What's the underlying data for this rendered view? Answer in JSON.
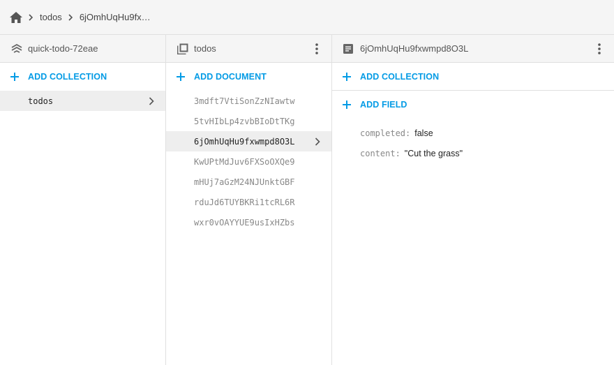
{
  "breadcrumb": {
    "home_icon": "home-icon",
    "items": [
      "todos",
      "6jOmhUqHu9fx…"
    ]
  },
  "colors": {
    "accent": "#039be5",
    "header_bg": "#f5f5f5",
    "selected_bg": "#eeeeee"
  },
  "pane_project": {
    "title": "quick-todo-72eae",
    "icon": "firestore-stack-icon",
    "action_label": "ADD COLLECTION",
    "items": [
      {
        "label": "todos",
        "selected": true
      }
    ]
  },
  "pane_collection": {
    "title": "todos",
    "icon": "collection-icon",
    "action_label": "ADD DOCUMENT",
    "items": [
      {
        "label": "3mdft7VtiSonZzNIawtw"
      },
      {
        "label": "5tvHIbLp4zvbBIoDtTKg"
      },
      {
        "label": "6jOmhUqHu9fxwmpd8O3L",
        "selected": true
      },
      {
        "label": "KwUPtMdJuv6FXSoOXQe9"
      },
      {
        "label": "mHUj7aGzM24NJUnktGBF"
      },
      {
        "label": "rduJd6TUYBKRi1tcRL6R"
      },
      {
        "label": "wxr0vOAYYUE9usIxHZbs"
      }
    ]
  },
  "pane_document": {
    "title": "6jOmhUqHu9fxwmpd8O3L",
    "icon": "document-icon",
    "add_collection_label": "ADD COLLECTION",
    "add_field_label": "ADD FIELD",
    "fields": [
      {
        "name": "completed:",
        "value": "false"
      },
      {
        "name": "content:",
        "value": "\"Cut the grass\""
      }
    ]
  }
}
